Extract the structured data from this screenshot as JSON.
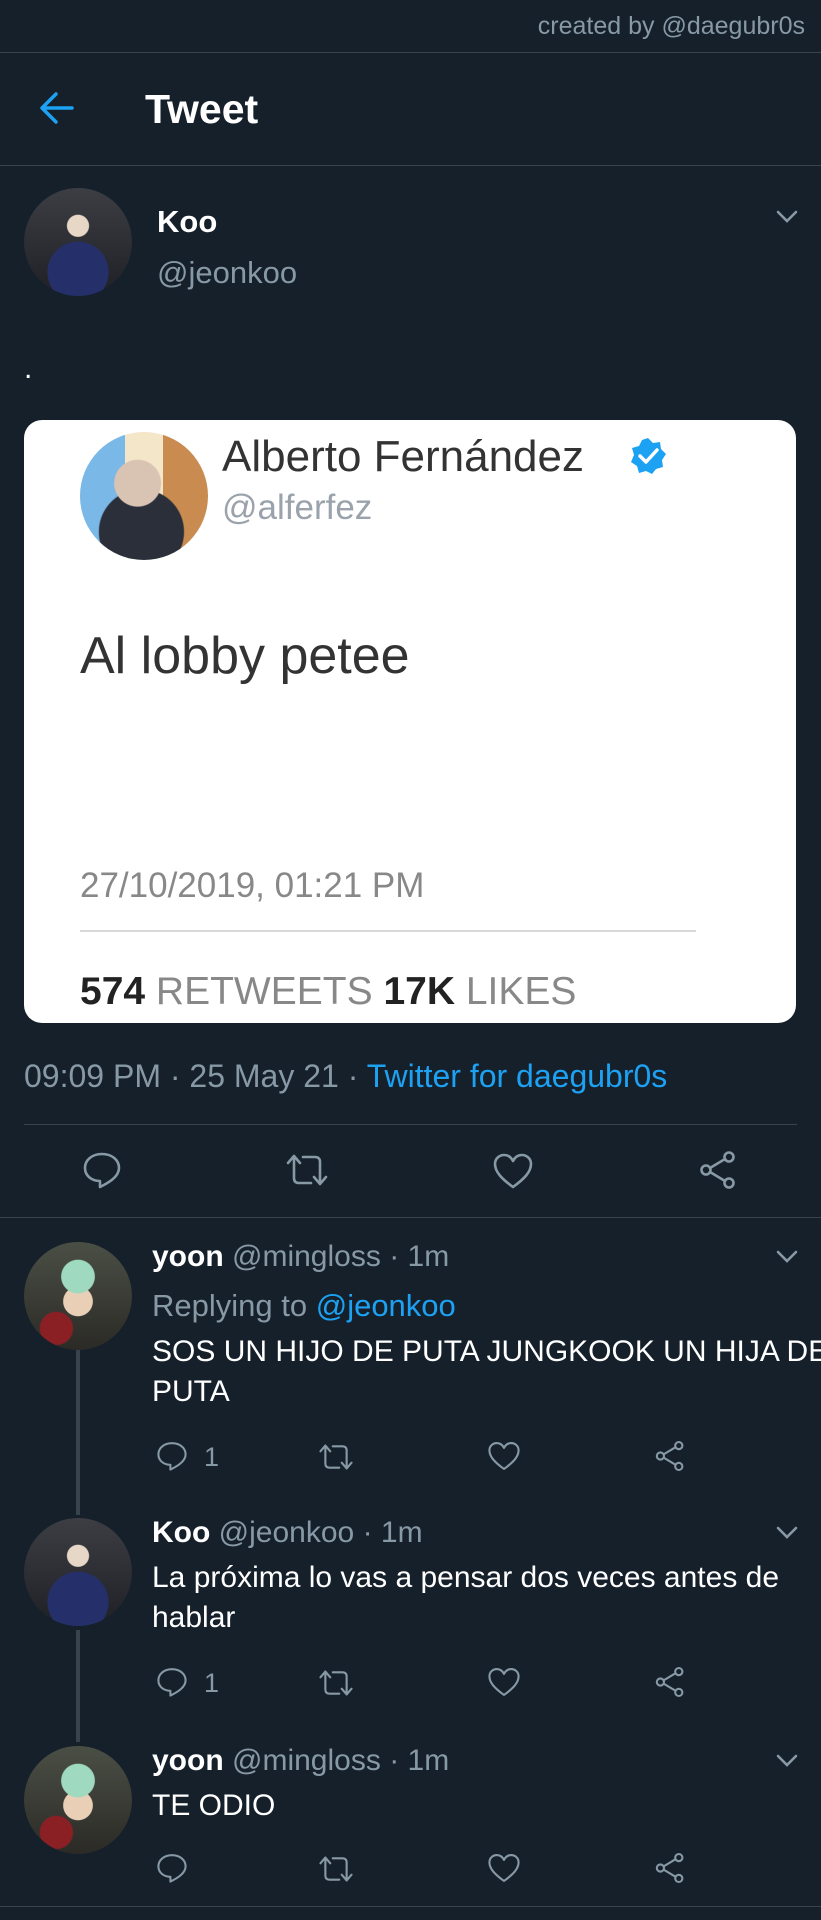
{
  "credit": "created by @daegubr0s",
  "header": {
    "title": "Tweet"
  },
  "tweet": {
    "name": "Koo",
    "handle": "@jeonkoo",
    "text": ".",
    "embedded": {
      "name": "Alberto Fernández",
      "handle": "@alferfez",
      "text": "Al lobby petee",
      "date": "27/10/2019, 01:21 PM",
      "retweets_count": "574",
      "retweets_label": "RETWEETS",
      "likes_count": "17K",
      "likes_label": "LIKES"
    },
    "time": "09:09 PM",
    "date": "25 May 21",
    "separator": "·",
    "source": "Twitter for daegubr0s"
  },
  "replies": [
    {
      "name": "yoon",
      "handle": "@mingloss",
      "time": "· 1m",
      "replying_label": "Replying to",
      "replying_to": "@jeonkoo",
      "text": "SOS UN HIJO DE PUTA JUNGKOOK UN HIJA DE PUTA",
      "reply_count": "1"
    },
    {
      "name": "Koo",
      "handle": "@jeonkoo",
      "time": "· 1m",
      "text": "La próxima lo vas a pensar dos veces antes de hablar",
      "reply_count": "1"
    },
    {
      "name": "yoon",
      "handle": "@mingloss",
      "time": "· 1m",
      "text": "TE ODIO"
    }
  ],
  "icons": [
    "back-arrow-icon",
    "chevron-down-icon",
    "verified-badge-icon",
    "reply-icon",
    "retweet-icon",
    "like-icon",
    "share-icon"
  ],
  "colors": {
    "background": "#15202b",
    "accent": "#1da1f2",
    "muted": "#8899a6",
    "divider": "#38444d"
  }
}
